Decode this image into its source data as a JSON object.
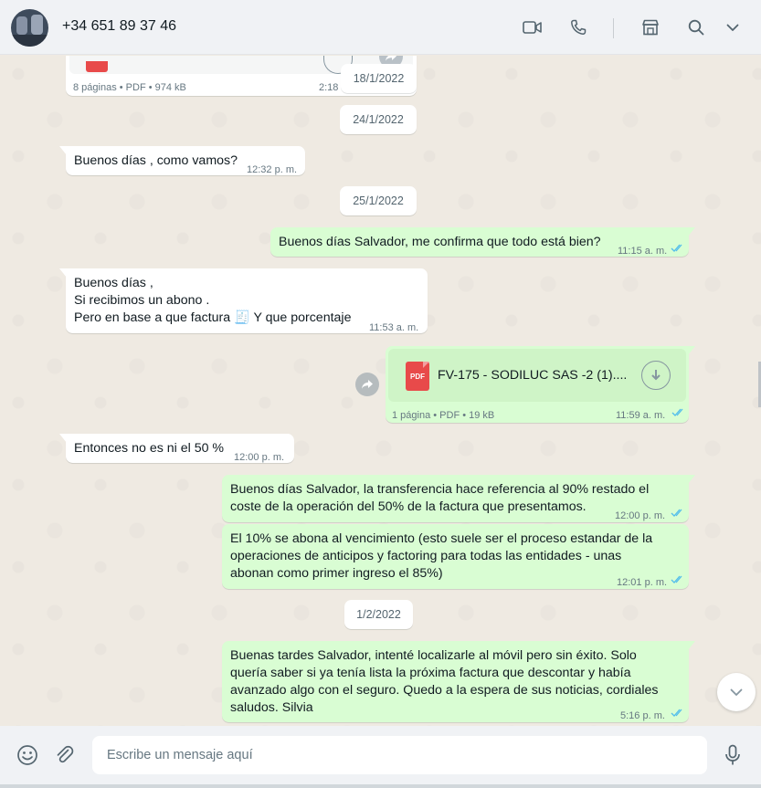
{
  "header": {
    "contact_name": "+34 651 89 37 46",
    "icons": [
      "video-call-icon",
      "voice-call-icon",
      "catalog-icon",
      "search-icon",
      "menu-chevron-icon"
    ]
  },
  "messages": {
    "top_doc_meta": "8 páginas • PDF • 974 kB",
    "top_doc_time": "2:18",
    "date_1": "18/1/2022",
    "date_2": "24/1/2022",
    "m1_text": "Buenos días , como vamos?",
    "m1_time": "12:32 p. m.",
    "date_3": "25/1/2022",
    "m2_text": "Buenos días Salvador, me confirma que todo está bien?",
    "m2_time": "11:15 a. m.",
    "m3_text": "Buenos días ,\nSi recibimos un abono .\nPero en base a que factura 🧾 Y que porcentaje",
    "m3_time": "11:53 a. m.",
    "doc_name": "FV-175 - SODILUC SAS -2 (1)....",
    "doc_meta": "1 página • PDF • 19 kB",
    "doc_time": "11:59 a. m.",
    "m4_text": "Entonces no es ni el 50 %",
    "m4_time": "12:00 p. m.",
    "m5_text": "Buenos días Salvador, la transferencia hace referencia al 90% restado el\ncoste de la operación del 50% de la factura que presentamos.",
    "m5_time": "12:00 p. m.",
    "m6_text": "El 10% se abona al vencimiento (esto suele ser el proceso estandar de la\noperaciones de anticipos y factoring para todas las entidades - unas\nabonan como primer ingreso el 85%)",
    "m6_time": "12:01 p. m.",
    "date_4": "1/2/2022",
    "m7_text": "Buenas tardes Salvador, intenté localizarle al móvil pero sin éxito. Solo\nquería saber si ya tenía lista la próxima factura que descontar y había\navanzado algo con el seguro. Quedo a la espera de sus noticias, cordiales\nsaludos. Silvia",
    "m7_time": "5:16 p. m.",
    "pdf_label": "PDF"
  },
  "composer": {
    "placeholder": "Escribe un mensaje aquí",
    "value": ""
  },
  "colors": {
    "outgoing_bubble": "#d9fdd3",
    "incoming_bubble": "#ffffff",
    "read_ticks": "#53bdeb",
    "pdf_red": "#e84a4a"
  }
}
